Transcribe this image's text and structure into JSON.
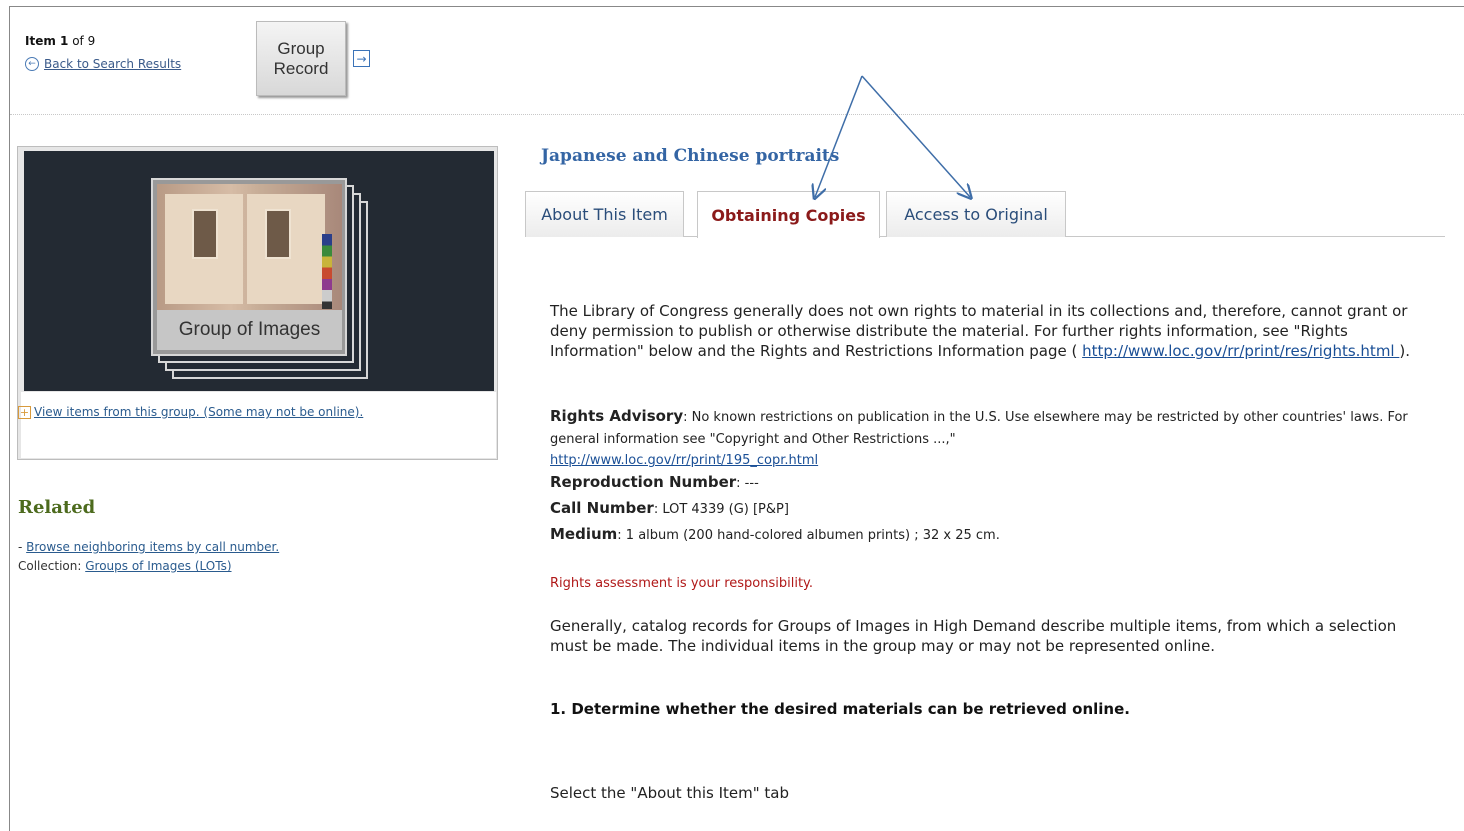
{
  "header": {
    "item_label": "Item 1",
    "item_of": "of 9",
    "back_link": "Back to Search Results",
    "group_button_line1": "Group",
    "group_button_line2": "Record"
  },
  "thumbnail": {
    "group_label": "Group of Images",
    "view_items_link": "View items from this group. (Some may not be online)."
  },
  "related": {
    "title": "Related",
    "browse_prefix": "- ",
    "browse_link": "Browse neighboring items by call number.",
    "collection_label": "Collection: ",
    "collection_link": "Groups of Images (LOTs)"
  },
  "item": {
    "title": "Japanese and Chinese portraits"
  },
  "tabs": [
    {
      "label": "About This Item"
    },
    {
      "label": "Obtaining Copies"
    },
    {
      "label": "Access to Original"
    }
  ],
  "content": {
    "intro_text": "The Library of Congress generally does not own rights to material in its collections and, therefore, cannot grant or deny permission to publish or otherwise distribute the material. For further rights information, see \"Rights Information\" below and the Rights and Restrictions Information page (",
    "intro_link": "http://www.loc.gov/rr/print/res/rights.html ",
    "intro_end": ").",
    "rights_advisory_label": "Rights Advisory",
    "rights_advisory_text": ": No known restrictions on publication in the U.S. Use elsewhere may be restricted by other countries' laws. For general information see \"Copyright and Other Restrictions ...,\"",
    "rights_advisory_link": "http://www.loc.gov/rr/print/195_copr.html",
    "reproduction_label": "Reproduction Number",
    "reproduction_value": ": ---",
    "call_number_label": "Call Number",
    "call_number_value": ": LOT 4339 (G) [P&P]",
    "medium_label": "Medium",
    "medium_value": ": 1 album (200 hand-colored albumen prints) ; 32 x 25 cm.",
    "assessment": "Rights assessment is your responsibility.",
    "general_text": "Generally, catalog records for Groups of Images in High Demand describe multiple items, from which a selection must be made. The individual items in the group may or may not be represented online.",
    "step1": "1. Determine whether the desired materials can be retrieved online.",
    "select_tab": "Select the \"About this Item\" tab"
  },
  "colors": {
    "annotation_arrow": "#3f6ea8",
    "active_tab_text": "#8b1a1a",
    "title_blue": "#3465a4",
    "related_green": "#4d6b1e"
  }
}
